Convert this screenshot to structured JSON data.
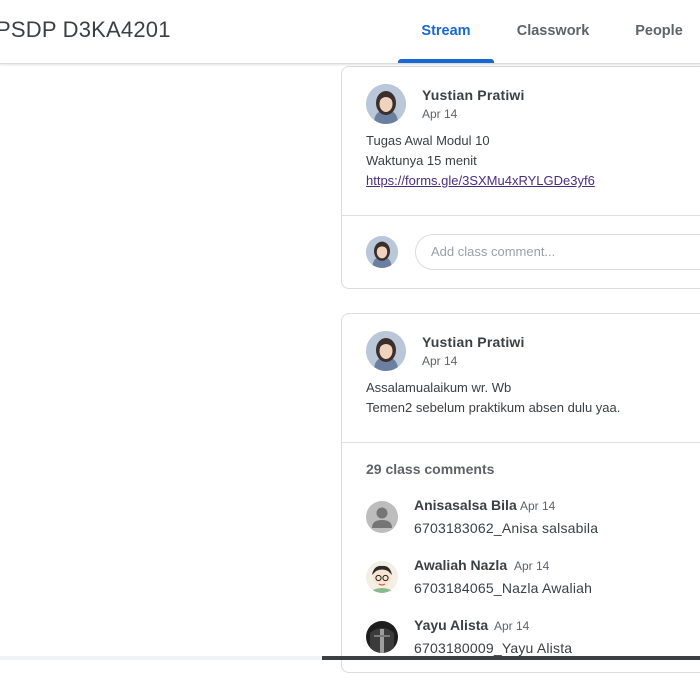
{
  "header": {
    "class_title": "PSDP D3KA4201",
    "tabs": [
      {
        "label": "Stream",
        "active": true
      },
      {
        "label": "Classwork",
        "active": false
      },
      {
        "label": "People",
        "active": false
      }
    ]
  },
  "posts": [
    {
      "author": "Yustian Pratiwi",
      "date": "Apr 14",
      "lines": [
        "Tugas Awal Modul 10",
        "Waktunya 15 menit"
      ],
      "link": "https://forms.gle/3SXMu4xRYLGDe3yf6",
      "comment_placeholder": "Add class comment..."
    },
    {
      "author": "Yustian Pratiwi",
      "date": "Apr 14",
      "lines": [
        "Assalamualaikum wr. Wb",
        "Temen2 sebelum praktikum absen dulu yaa."
      ],
      "comments_count": "29 class comments",
      "comments": [
        {
          "author": "Anisasalsa Bila",
          "date": "Apr 14",
          "text": "6703183062_Anisa salsabila",
          "avatar": "default-person-icon"
        },
        {
          "author": "Awaliah Nazla",
          "date": "Apr 14",
          "text": "6703184065_Nazla Awaliah",
          "avatar": "cartoon-girl-avatar"
        },
        {
          "author": "Yayu Alista",
          "date": "Apr 14",
          "text": "6703180009_Yayu Alista",
          "avatar": "dark-photo-avatar"
        }
      ]
    }
  ],
  "colors": {
    "accent": "#1967d2",
    "text": "#3c4043",
    "muted": "#5f6368",
    "border": "#dadce0"
  }
}
